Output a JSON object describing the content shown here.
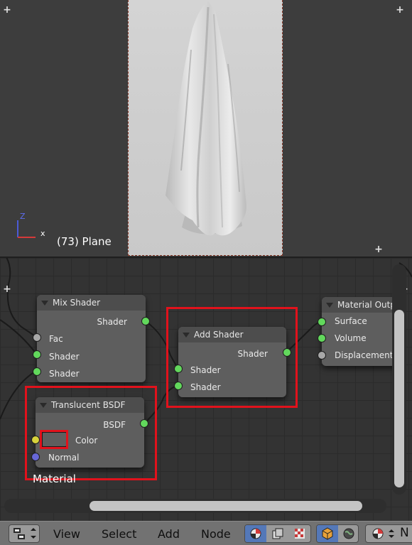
{
  "viewport": {
    "object_label": "(73) Plane",
    "axis_z": "Z"
  },
  "nodes": {
    "mix_shader": {
      "title": "Mix Shader",
      "output": "Shader",
      "inputs": [
        "Fac",
        "Shader",
        "Shader"
      ]
    },
    "add_shader": {
      "title": "Add Shader",
      "output": "Shader",
      "inputs": [
        "Shader",
        "Shader"
      ]
    },
    "translucent": {
      "title": "Translucent BSDF",
      "output": "BSDF",
      "inputs": [
        "Color",
        "Normal"
      ]
    },
    "material_output": {
      "title": "Material Outp",
      "inputs": [
        "Surface",
        "Volume",
        "Displacement"
      ]
    }
  },
  "editor": {
    "material_label": "Material"
  },
  "header": {
    "menu": [
      "View",
      "Select",
      "Add",
      "Node"
    ],
    "truncated_label": "N"
  },
  "colors": {
    "socket_shader": "#62d85c",
    "socket_value": "#a8a8a8",
    "socket_color": "#d7d23b",
    "socket_vector": "#6767d6",
    "highlight": "#e1121c"
  },
  "icons": [
    "editor-type-icon",
    "shader-material-icon",
    "texture-icon",
    "compositing-icon",
    "object-icon",
    "world-icon",
    "render-preview-icon"
  ]
}
